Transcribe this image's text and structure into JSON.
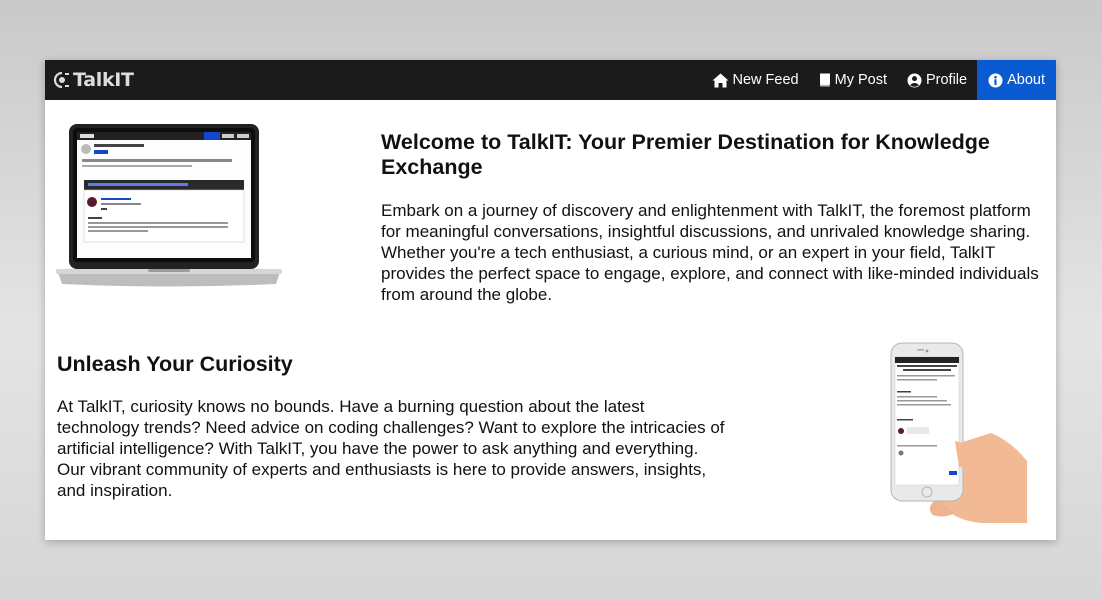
{
  "brand": {
    "name": "TalkIT"
  },
  "nav": {
    "items": [
      {
        "label": "New Feed",
        "icon": "home-icon"
      },
      {
        "label": "My Post",
        "icon": "book-icon"
      },
      {
        "label": "Profile",
        "icon": "user-circle-icon"
      },
      {
        "label": "About",
        "icon": "info-circle-icon",
        "active": true
      }
    ]
  },
  "hero": {
    "title": "Welcome to TalkIT: Your Premier Destination for Knowledge Exchange",
    "text": "Embark on a journey of discovery and enlightenment with TalkIT, the foremost platform for meaningful conversations, insightful discussions, and unrivaled knowledge sharing. Whether you're a tech enthusiast, a curious mind, or an expert in your field, TalkIT provides the perfect space to engage, explore, and connect with like-minded individuals from around the globe."
  },
  "curiosity": {
    "title": "Unleash Your Curiosity",
    "text": "At TalkIT, curiosity knows no bounds. Have a burning question about the latest technology trends? Need advice on coding challenges? Want to explore the intricacies of artificial intelligence? With TalkIT, you have the power to ask anything and everything. Our vibrant community of experts and enthusiasts is here to provide answers, insights, and inspiration."
  },
  "colors": {
    "navbar": "#1b1b1b",
    "accent": "#0a5ad1",
    "text": "#111111"
  }
}
